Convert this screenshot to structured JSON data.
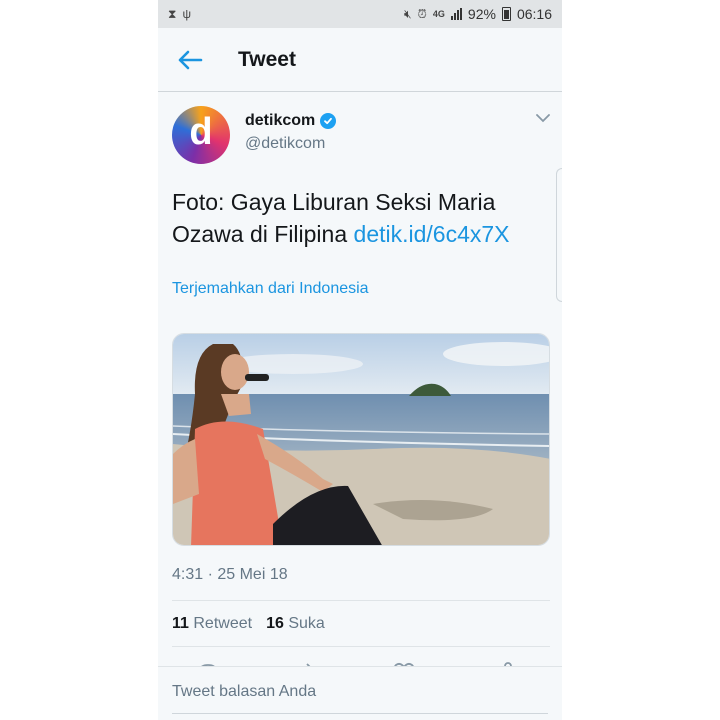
{
  "status_bar": {
    "battery": "92%",
    "time": "06:16",
    "network": "4G"
  },
  "header": {
    "title": "Tweet"
  },
  "tweet": {
    "avatar_letter": "d",
    "author_name": "detikcom",
    "author_handle": "@detikcom",
    "text": "Foto: Gaya Liburan Seksi Maria Ozawa di Filipina",
    "link_text": "detik.id/6c4x7X",
    "translate_label": "Terjemahkan dari Indonesia",
    "timestamp": "4:31 · 25 Mei 18",
    "retweet_count": "11",
    "retweet_label": "Retweet",
    "like_count": "16",
    "like_label": "Suka"
  },
  "reply": {
    "placeholder": "Tweet balasan Anda"
  },
  "colors": {
    "accent": "#1b95e0",
    "verified": "#1da1f2",
    "background": "#f5f8fa"
  },
  "icons": [
    "back-arrow-icon",
    "verified-icon",
    "chevron-down-icon",
    "reply-icon",
    "retweet-icon",
    "like-icon",
    "share-icon"
  ]
}
